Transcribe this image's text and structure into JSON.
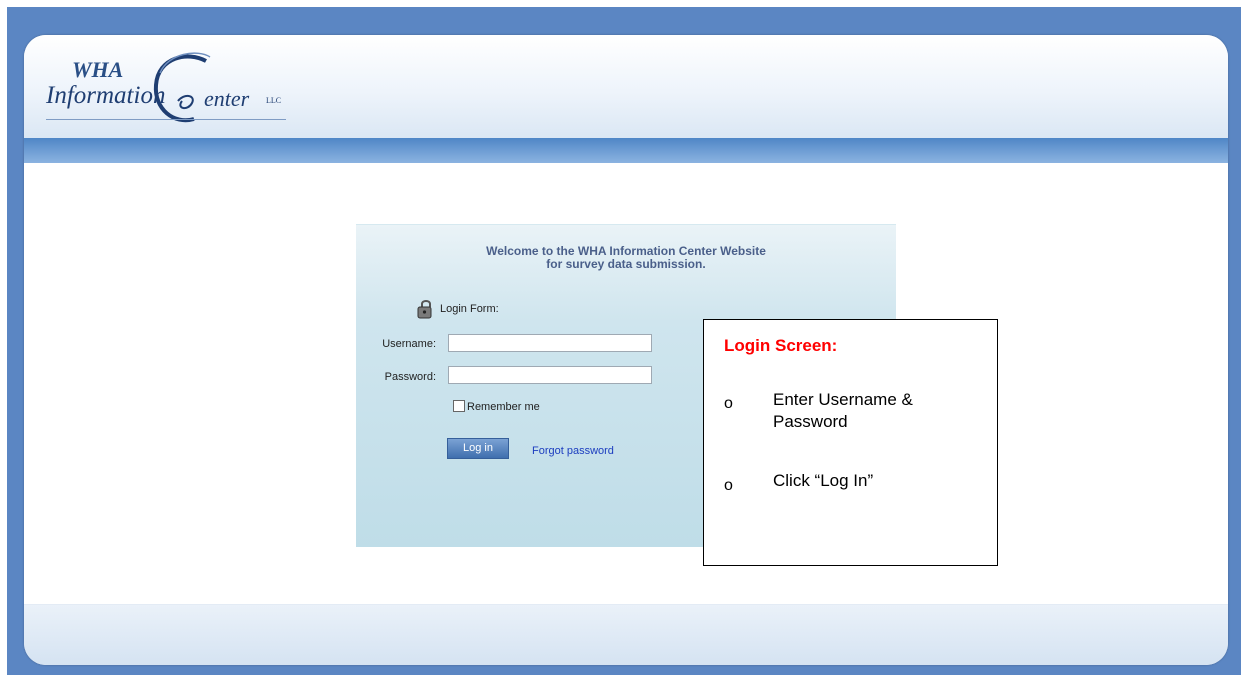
{
  "logo": {
    "top": "WHA",
    "left": "Information",
    "right": "enter",
    "suffix": "LLC"
  },
  "login": {
    "welcome_line1": "Welcome to the WHA Information Center Website",
    "welcome_line2": "for survey data submission.",
    "form_title": "Login Form:",
    "username_label": "Username:",
    "username_value": "",
    "password_label": "Password:",
    "password_value": "",
    "remember_label": "Remember me",
    "login_button": "Log in",
    "forgot_link": "Forgot password"
  },
  "callout": {
    "title": "Login Screen:",
    "bullet": "o",
    "step1": "Enter Username &",
    "step1_cont": "Password",
    "step2": "Click “Log In”"
  },
  "colors": {
    "frame": "#5b86c3",
    "callout_title": "#ff0000",
    "link": "#1c3dbf"
  }
}
